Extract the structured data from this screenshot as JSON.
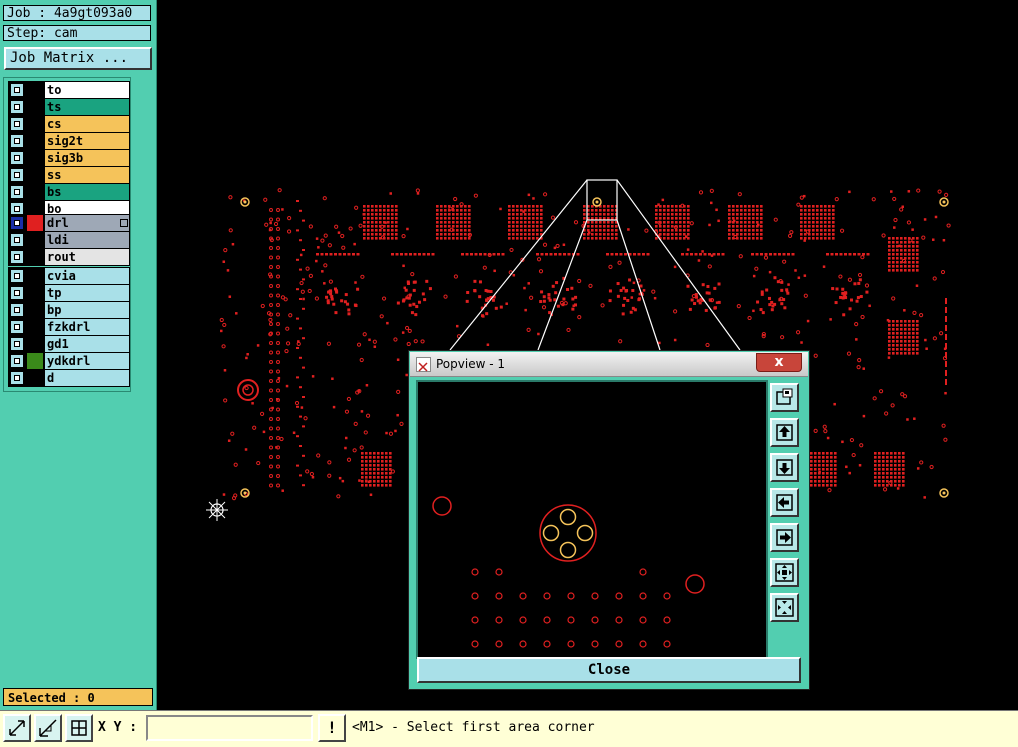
{
  "job_panel": {
    "job": "Job : 4a9gt093a0",
    "step": "Step: cam",
    "matrix_button": "Job Matrix ...",
    "selected": "Selected : 0"
  },
  "layers": {
    "board": [
      {
        "name": "to",
        "color": "#ffffff",
        "swatch": "#000000"
      },
      {
        "name": "ts",
        "color": "#1aa380",
        "swatch": "#000000"
      },
      {
        "name": "cs",
        "color": "#f5c35a",
        "swatch": "#000000"
      },
      {
        "name": "sig2t",
        "color": "#f5c35a",
        "swatch": "#000000"
      },
      {
        "name": "sig3b",
        "color": "#f5c35a",
        "swatch": "#000000"
      },
      {
        "name": "ss",
        "color": "#f5c35a",
        "swatch": "#000000"
      },
      {
        "name": "bs",
        "color": "#1aa380",
        "swatch": "#000000"
      },
      {
        "name": "bo",
        "color": "#ffffff",
        "swatch": "#000000"
      }
    ],
    "drill": [
      {
        "name": "drl",
        "color": "#9ea8b6",
        "swatch": "#e02020",
        "active": true
      },
      {
        "name": "ldi",
        "color": "#9ea8b6",
        "swatch": "#000000"
      },
      {
        "name": "rout",
        "color": "#e4e4e4",
        "swatch": "#000000"
      }
    ],
    "misc": [
      {
        "name": "cvia",
        "color": "#a9e0e8",
        "swatch": "#000000"
      },
      {
        "name": "tp",
        "color": "#a9e0e8",
        "swatch": "#000000"
      },
      {
        "name": "bp",
        "color": "#a9e0e8",
        "swatch": "#000000"
      },
      {
        "name": "fzkdrl",
        "color": "#a9e0e8",
        "swatch": "#000000"
      },
      {
        "name": "gd1",
        "color": "#a9e0e8",
        "swatch": "#000000"
      },
      {
        "name": "ydkdrl",
        "color": "#a9e0e8",
        "swatch": "#3a8a1a"
      },
      {
        "name": "d",
        "color": "#a9e0e8",
        "swatch": "#000000"
      }
    ]
  },
  "popview": {
    "title": "Popview - 1",
    "close_x": "x",
    "close_button": "Close"
  },
  "status_bar": {
    "xy_label": "X Y :",
    "xy_value": "",
    "message": "<M1> - Select first area corner",
    "alert": "!"
  },
  "colors": {
    "panel": "#52ceb0",
    "feature": "#e02020",
    "highlight": "#f5c35a"
  }
}
